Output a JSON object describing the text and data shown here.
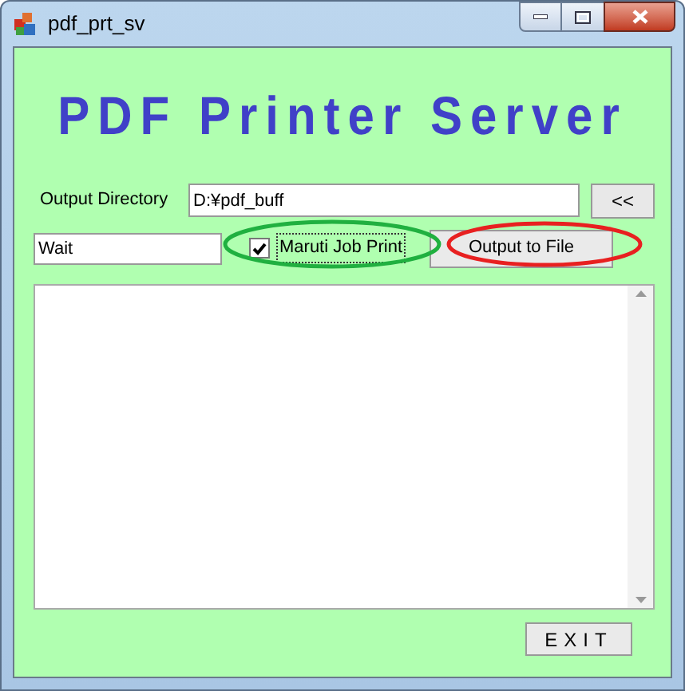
{
  "window": {
    "title": "pdf_prt_sv"
  },
  "heading": "PDF Printer Server",
  "output_directory": {
    "label": "Output Directory",
    "value": "D:¥pdf_buff",
    "browse_button": "<<"
  },
  "status_field": {
    "value": "Wait"
  },
  "job_print": {
    "label": "Maruti Job Print",
    "checked": true
  },
  "output_button": "Output to File",
  "annotations": [
    {
      "kind": "ellipse",
      "color": "#20b040"
    },
    {
      "kind": "ellipse",
      "color": "#e82020"
    }
  ],
  "exit_button": "EXIT"
}
